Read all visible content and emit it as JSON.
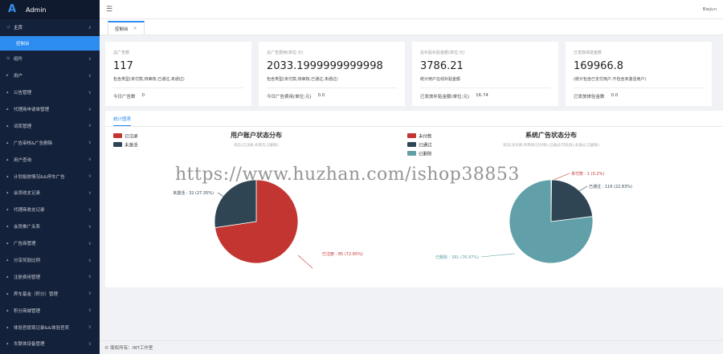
{
  "app": {
    "brand_letter": "A",
    "title": "Admin"
  },
  "topbar": {
    "menu_icon": "☰",
    "user": "BieJun"
  },
  "sidebar": {
    "items": [
      {
        "label": "主页",
        "icon": "◁",
        "expanded": true,
        "chevron": "∧"
      },
      {
        "label": "组件",
        "icon": "⊙",
        "chevron": "∨"
      },
      {
        "label": "用户",
        "icon": "▸",
        "chevron": "∨"
      },
      {
        "label": "公告管理",
        "icon": "▴",
        "chevron": "∨"
      },
      {
        "label": "代理商申请单管理",
        "icon": "▴",
        "chevron": "∨"
      },
      {
        "label": "词库管理",
        "icon": "▴",
        "chevron": "∨"
      },
      {
        "label": "广告审核&广告删除",
        "icon": "▴",
        "chevron": "∨"
      },
      {
        "label": "用户查询",
        "icon": "▴",
        "chevron": "∨"
      },
      {
        "label": "计划投放情况&&停车广告",
        "icon": "▴",
        "chevron": "∨"
      },
      {
        "label": "会员收支记录",
        "icon": "▴",
        "chevron": "∨"
      },
      {
        "label": "代理商收支记录",
        "icon": "▴",
        "chevron": "∨"
      },
      {
        "label": "会员推广关系",
        "icon": "▴",
        "chevron": "∨"
      },
      {
        "label": "广告商管理",
        "icon": "▴",
        "chevron": "∨"
      },
      {
        "label": "分享奖励比例",
        "icon": "▴",
        "chevron": "∨"
      },
      {
        "label": "注册费用管理",
        "icon": "▴",
        "chevron": "∨"
      },
      {
        "label": "养车基金（积分）管理",
        "icon": "▴",
        "chevron": "∨"
      },
      {
        "label": "积分商城管理",
        "icon": "▴",
        "chevron": "∨"
      },
      {
        "label": "体验官提现记录&&体验官奖",
        "icon": "▴",
        "chevron": "∨"
      },
      {
        "label": "车联体设备管理",
        "icon": "▴",
        "chevron": "∨"
      }
    ],
    "active_sub": "控制台"
  },
  "tabs": [
    {
      "label": "控制台",
      "close": "×"
    }
  ],
  "cards": [
    {
      "label": "总广告数",
      "value": "117",
      "desc": "包含类型(未付款,待审核,已通过,未通过)",
      "foot_label": "今日广告数",
      "foot_value": "0"
    },
    {
      "label": "总广告费用(单位:元)",
      "value": "2033.1999999999998",
      "desc": "包含类型(未付款,待审核,已通过,未通过)",
      "foot_label": "今日广告费用(单位:元)",
      "foot_value": "0.0"
    },
    {
      "label": "总补贴补贴金额(单位:元)",
      "value": "3786.21",
      "desc": "统计用户在线补贴金额",
      "foot_label": "已发放补贴金额(单位:元)",
      "foot_value": "16.74"
    },
    {
      "label": "已发放体验金数",
      "value": "169966.8",
      "desc": "(统计包含已支付用户,不包含未激活用户)",
      "foot_label": "已发放体验金数",
      "foot_value": "0.0"
    }
  ],
  "panel": {
    "tab_label": "统计图表"
  },
  "chart_data": [
    {
      "type": "pie",
      "title": "用户账户状态分布",
      "subtitle": "状态(已注册,未激活,已删除)",
      "series": [
        {
          "name": "已注册",
          "value": 85,
          "label": "已注册 : 85 (72.65%)",
          "color": "#c23531"
        },
        {
          "name": "未激活",
          "value": 32,
          "label": "未激活 : 32 (27.35%)",
          "color": "#2f4554"
        }
      ],
      "legend_position": "top-left"
    },
    {
      "type": "pie",
      "title": "系统广告状态分布",
      "subtitle": "状态(未付款,待审核(已付款),已通过(可投放),未通过,已删除)",
      "series": [
        {
          "name": "未付款",
          "value": 1,
          "label": "未付款 : 1 (0.2%)",
          "color": "#c23531"
        },
        {
          "name": "已通过",
          "value": 116,
          "label": "已通过 : 116 (22.83%)",
          "color": "#2f4554"
        },
        {
          "name": "已删除",
          "value": 391,
          "label": "已删除 : 391 (76.97%)",
          "color": "#61a0a8"
        }
      ],
      "legend_position": "top-left"
    }
  ],
  "footer": {
    "text": "© 版权所有：INT工作室"
  },
  "watermark": "https://www.huzhan.com/ishop38853"
}
